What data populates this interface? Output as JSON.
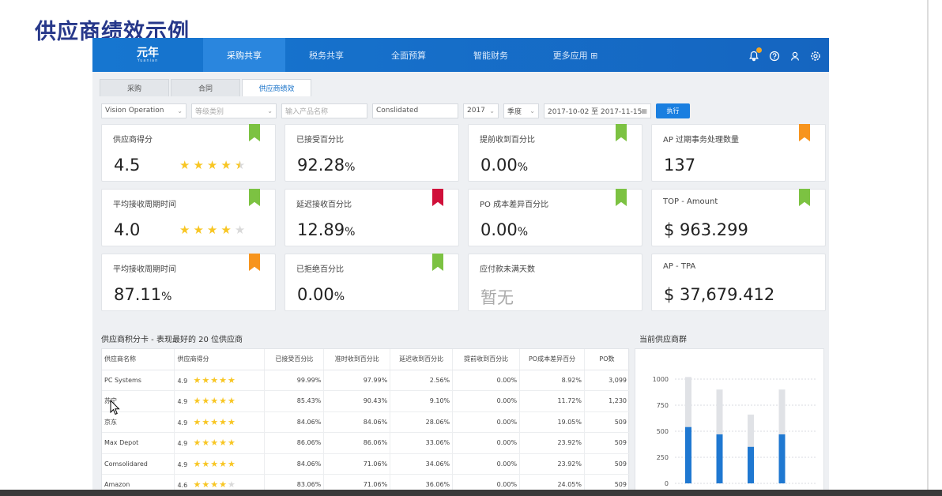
{
  "slide_title": "供应商绩效示例",
  "app": {
    "logo": {
      "main": "元年",
      "sub": "Yuanian"
    },
    "nav": [
      "采购共享",
      "税务共享",
      "全面预算",
      "智能财务",
      "更多应用 ⊞"
    ],
    "tabs": [
      "采购",
      "合同",
      "供应商绩效"
    ],
    "filters": {
      "org": "Vision Operation",
      "grade_ph": "等级类别",
      "product_ph": "输入产品名称",
      "scenario": "Conslidated",
      "year": "2017",
      "period": "季度",
      "date_range": "2017-10-02 至 2017-11-15",
      "run": "执行"
    },
    "colors": {
      "green": "#7cc242",
      "red": "#d0103a",
      "orange": "#f7941d",
      "star": "#f8c623",
      "star_empty": "#d9d9d9",
      "bar_blue": "#1f78d1",
      "bar_gray": "#e0e2e6"
    },
    "kpis": [
      {
        "label": "供应商得分",
        "value": "4.5",
        "unit": "",
        "ribbon": "green",
        "stars": 4.5
      },
      {
        "label": "已接受百分比",
        "value": "92.28",
        "unit": "%",
        "ribbon": ""
      },
      {
        "label": "提前收到百分比",
        "value": "0.00",
        "unit": "%",
        "ribbon": "green"
      },
      {
        "label": "AP 过期事务处理数量",
        "value": "137",
        "unit": "",
        "ribbon": "orange"
      },
      {
        "label": "平均接收周期时间",
        "value": "4.0",
        "unit": "",
        "ribbon": "green",
        "stars": 4
      },
      {
        "label": "延迟接收百分比",
        "value": "12.89",
        "unit": "%",
        "ribbon": "red"
      },
      {
        "label": "PO 成本差异百分比",
        "value": "0.00",
        "unit": "%",
        "ribbon": "green"
      },
      {
        "label": "TOP - Amount",
        "value": "$ 963.299",
        "unit": "",
        "ribbon": "green"
      },
      {
        "label": "平均接收周期时间",
        "value": "87.11",
        "unit": "%",
        "ribbon": "orange"
      },
      {
        "label": "已拒绝百分比",
        "value": "0.00",
        "unit": "%",
        "ribbon": "green"
      },
      {
        "label": "应付款未满天数",
        "value": "暂无",
        "unit": "",
        "ribbon": "",
        "muted": true
      },
      {
        "label": "AP - TPA",
        "value": "$ 37,679.412",
        "unit": "",
        "ribbon": ""
      }
    ],
    "scorecard": {
      "title": "供应商积分卡 - 表现最好的 20 位供应商",
      "headers": [
        "供应商名称",
        "供应商得分",
        "已接受百分比",
        "准时收到百分比",
        "延迟收到百分比",
        "提前收到百分比",
        "PO成本差异百分",
        "PO数"
      ],
      "rows": [
        {
          "name": "PC Systems",
          "score": "4.9",
          "stars": 5,
          "accepted": "99.99%",
          "ontime": "97.99%",
          "late": "2.56%",
          "early": "0.00%",
          "cost": "8.92%",
          "po": "3,099"
        },
        {
          "name": "苏宁",
          "score": "4.9",
          "stars": 5,
          "accepted": "85.43%",
          "ontime": "90.43%",
          "late": "9.10%",
          "early": "0.00%",
          "cost": "11.72%",
          "po": "1,230"
        },
        {
          "name": "京东",
          "score": "4.9",
          "stars": 5,
          "accepted": "84.06%",
          "ontime": "84.06%",
          "late": "28.06%",
          "early": "0.00%",
          "cost": "19.05%",
          "po": "509"
        },
        {
          "name": "Max Depot",
          "score": "4.9",
          "stars": 5,
          "accepted": "86.06%",
          "ontime": "86.06%",
          "late": "33.06%",
          "early": "0.00%",
          "cost": "23.92%",
          "po": "509"
        },
        {
          "name": "Comsolidared",
          "score": "4.9",
          "stars": 5,
          "accepted": "84.06%",
          "ontime": "71.06%",
          "late": "34.06%",
          "early": "0.00%",
          "cost": "23.92%",
          "po": "509"
        },
        {
          "name": "Amazon",
          "score": "4.6",
          "stars": 4,
          "accepted": "83.06%",
          "ontime": "71.06%",
          "late": "36.06%",
          "early": "0.00%",
          "cost": "24.05%",
          "po": "509"
        }
      ]
    },
    "group_title": "当前供应商群"
  },
  "chart_data": {
    "type": "bar",
    "title": "",
    "ylim": [
      0,
      1000
    ],
    "yticks": [
      0,
      250,
      500,
      750,
      1000
    ],
    "grid": true,
    "series": [
      {
        "values": [
          1020,
          900,
          660,
          900
        ]
      },
      {
        "values": [
          540,
          470,
          350,
          470
        ]
      }
    ]
  }
}
